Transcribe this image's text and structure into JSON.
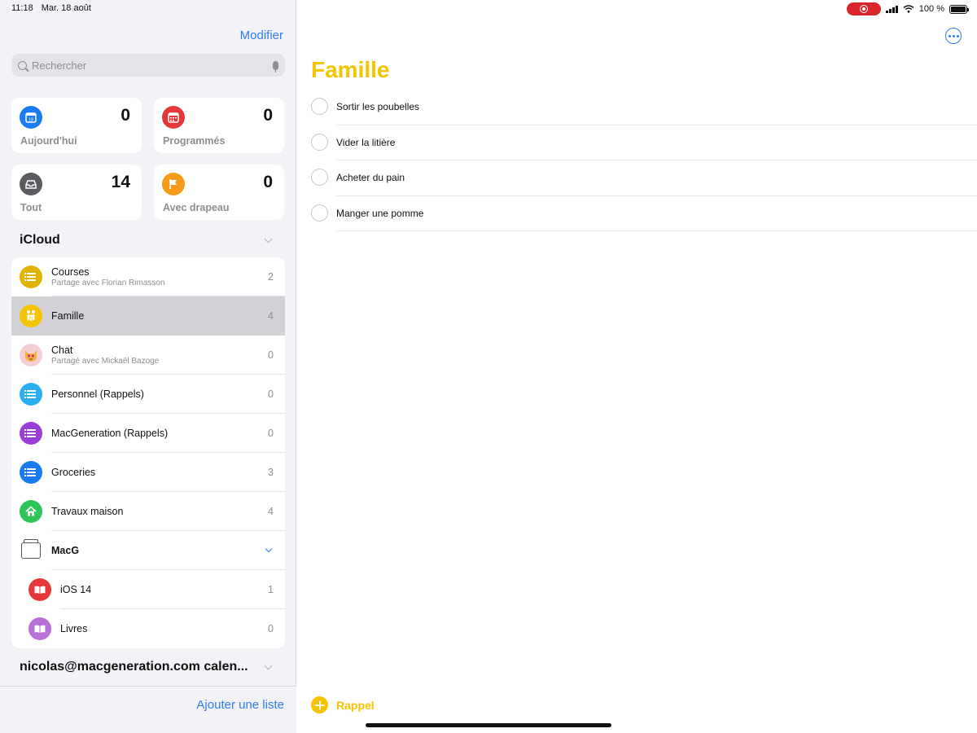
{
  "status_bar": {
    "time": "11:18",
    "date": "Mar. 18 août",
    "battery_text": "100 %",
    "recording_color": "#d9262d"
  },
  "sidebar": {
    "edit_label": "Modifier",
    "search": {
      "placeholder": "Rechercher",
      "value": ""
    },
    "smart_lists": [
      {
        "label": "Aujourd'hui",
        "count": "0",
        "icon": "calendar-today-icon",
        "color": "#1a7cf5"
      },
      {
        "label": "Programmés",
        "count": "0",
        "icon": "calendar-grid-icon",
        "color": "#e5383b"
      },
      {
        "label": "Tout",
        "count": "14",
        "icon": "tray-icon",
        "color": "#5b5b60"
      },
      {
        "label": "Avec drapeau",
        "count": "0",
        "icon": "flag-icon",
        "color": "#f59a1a"
      }
    ],
    "sections": [
      {
        "title": "iCloud"
      },
      {
        "title": "nicolas@macgeneration.com calen..."
      }
    ],
    "lists": [
      {
        "name": "Courses",
        "subtitle": "Partage avec Florian Rimasson",
        "count": "2",
        "icon": "list-icon",
        "color": "#e0b400"
      },
      {
        "name": "Famille",
        "subtitle": "",
        "count": "4",
        "icon": "family-icon",
        "color": "#f5c400",
        "selected": true
      },
      {
        "name": "Chat",
        "subtitle": "Partagé avec Mickaël Bazoge",
        "count": "0",
        "icon": "cat-face-icon",
        "color": "#f4b8c0"
      },
      {
        "name": "Personnel (Rappels)",
        "subtitle": "",
        "count": "0",
        "icon": "list-icon",
        "color": "#2ab0f0"
      },
      {
        "name": "MacGeneration (Rappels)",
        "subtitle": "",
        "count": "0",
        "icon": "list-icon",
        "color": "#9b3fd6"
      },
      {
        "name": "Groceries",
        "subtitle": "",
        "count": "3",
        "icon": "list-icon",
        "color": "#1a7cf5"
      },
      {
        "name": "Travaux maison",
        "subtitle": "",
        "count": "4",
        "icon": "house-icon",
        "color": "#2fc55b"
      }
    ],
    "group": {
      "name": "MacG",
      "icon": "folder-stack-icon",
      "items": [
        {
          "name": "iOS 14",
          "count": "1",
          "icon": "book-icon",
          "color": "#e5383b"
        },
        {
          "name": "Livres",
          "count": "0",
          "icon": "book-icon",
          "color": "#b86fd6"
        }
      ]
    },
    "add_list_label": "Ajouter une liste"
  },
  "main": {
    "title": "Famille",
    "accent_color": "#f5c400",
    "reminders": [
      {
        "title": "Sortir les poubelles"
      },
      {
        "title": "Vider la litière"
      },
      {
        "title": "Acheter du pain"
      },
      {
        "title": "Manger une pomme"
      }
    ],
    "add_reminder_label": "Rappel"
  }
}
